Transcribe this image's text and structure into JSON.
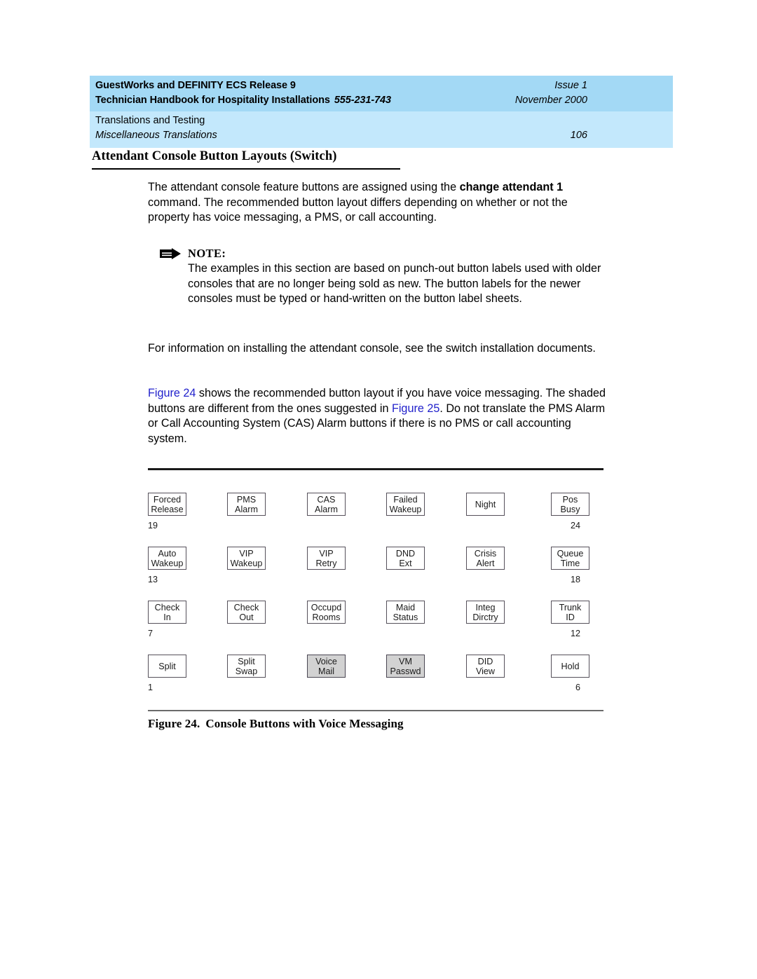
{
  "header": {
    "left_line1": "GuestWorks and DEFINITY ECS Release 9",
    "left_line2": "Technician Handbook for Hospitality Installations",
    "doc_number": "555-231-743",
    "right_line1": "Issue 1",
    "right_line2": "November 2000",
    "left_line3": "Translations and Testing",
    "left_line4": "Miscellaneous Translations",
    "page_number": "106",
    "band_top_color": "#a3d9f5",
    "band_bottom_color": "#c3e8fc"
  },
  "section": {
    "heading": "Attendant Console Button Layouts (Switch)"
  },
  "paragraphs": {
    "intro_pre": "The attendant console feature buttons are assigned using the ",
    "intro_cmd1": "change",
    "intro_cmd2": "attendant 1",
    "intro_post": " command. The recommended button layout differs depending on whether or not the property has voice messaging, a PMS, or call accounting.",
    "install": "For information on installing the attendant console, see the switch installation documents.",
    "figref_link1": "Figure 24",
    "figref_mid": " shows the recommended button layout if you have voice messaging. The shaded buttons are different from the ones suggested in ",
    "figref_link2": "Figure 25",
    "figref_tail": ". Do not translate the PMS Alarm or Call Accounting System (CAS) Alarm buttons if there is no PMS or call accounting system."
  },
  "note": {
    "icon": "note-arrow-icon",
    "label": "NOTE:",
    "text": "The examples in this section are based on punch-out button labels used with older consoles that are no longer being sold as new. The button labels for the newer consoles must be typed or hand-written on the button label sheets."
  },
  "figure": {
    "caption_number": "Figure 24.",
    "caption_title": "Console Buttons with Voice Messaging",
    "shaded_color": "#d2d2d2",
    "rows": [
      {
        "start_number": "19",
        "end_number": "24",
        "buttons": [
          {
            "line1": "Forced",
            "line2": "Release",
            "shaded": false
          },
          {
            "line1": "PMS",
            "line2": "Alarm",
            "shaded": false
          },
          {
            "line1": "CAS",
            "line2": "Alarm",
            "shaded": false
          },
          {
            "line1": "Failed",
            "line2": "Wakeup",
            "shaded": false
          },
          {
            "line1": "Night",
            "line2": "",
            "shaded": false
          },
          {
            "line1": "Pos",
            "line2": "Busy",
            "shaded": false
          }
        ]
      },
      {
        "start_number": "13",
        "end_number": "18",
        "buttons": [
          {
            "line1": "Auto",
            "line2": "Wakeup",
            "shaded": false
          },
          {
            "line1": "VIP",
            "line2": "Wakeup",
            "shaded": false
          },
          {
            "line1": "VIP",
            "line2": "Retry",
            "shaded": false
          },
          {
            "line1": "DND",
            "line2": "Ext",
            "shaded": false
          },
          {
            "line1": "Crisis",
            "line2": "Alert",
            "shaded": false
          },
          {
            "line1": "Queue",
            "line2": "Time",
            "shaded": false
          }
        ]
      },
      {
        "start_number": "7",
        "end_number": "12",
        "buttons": [
          {
            "line1": "Check",
            "line2": "In",
            "shaded": false
          },
          {
            "line1": "Check",
            "line2": "Out",
            "shaded": false
          },
          {
            "line1": "Occupd",
            "line2": "Rooms",
            "shaded": false
          },
          {
            "line1": "Maid",
            "line2": "Status",
            "shaded": false
          },
          {
            "line1": "Integ",
            "line2": "Dirctry",
            "shaded": false
          },
          {
            "line1": "Trunk",
            "line2": "ID",
            "shaded": false
          }
        ]
      },
      {
        "start_number": "1",
        "end_number": "6",
        "buttons": [
          {
            "line1": "Split",
            "line2": "",
            "shaded": false
          },
          {
            "line1": "Split",
            "line2": "Swap",
            "shaded": false
          },
          {
            "line1": "Voice",
            "line2": "Mail",
            "shaded": true
          },
          {
            "line1": "VM",
            "line2": "Passwd",
            "shaded": true
          },
          {
            "line1": "DID",
            "line2": "View",
            "shaded": false
          },
          {
            "line1": "Hold",
            "line2": "",
            "shaded": false
          }
        ]
      }
    ]
  }
}
